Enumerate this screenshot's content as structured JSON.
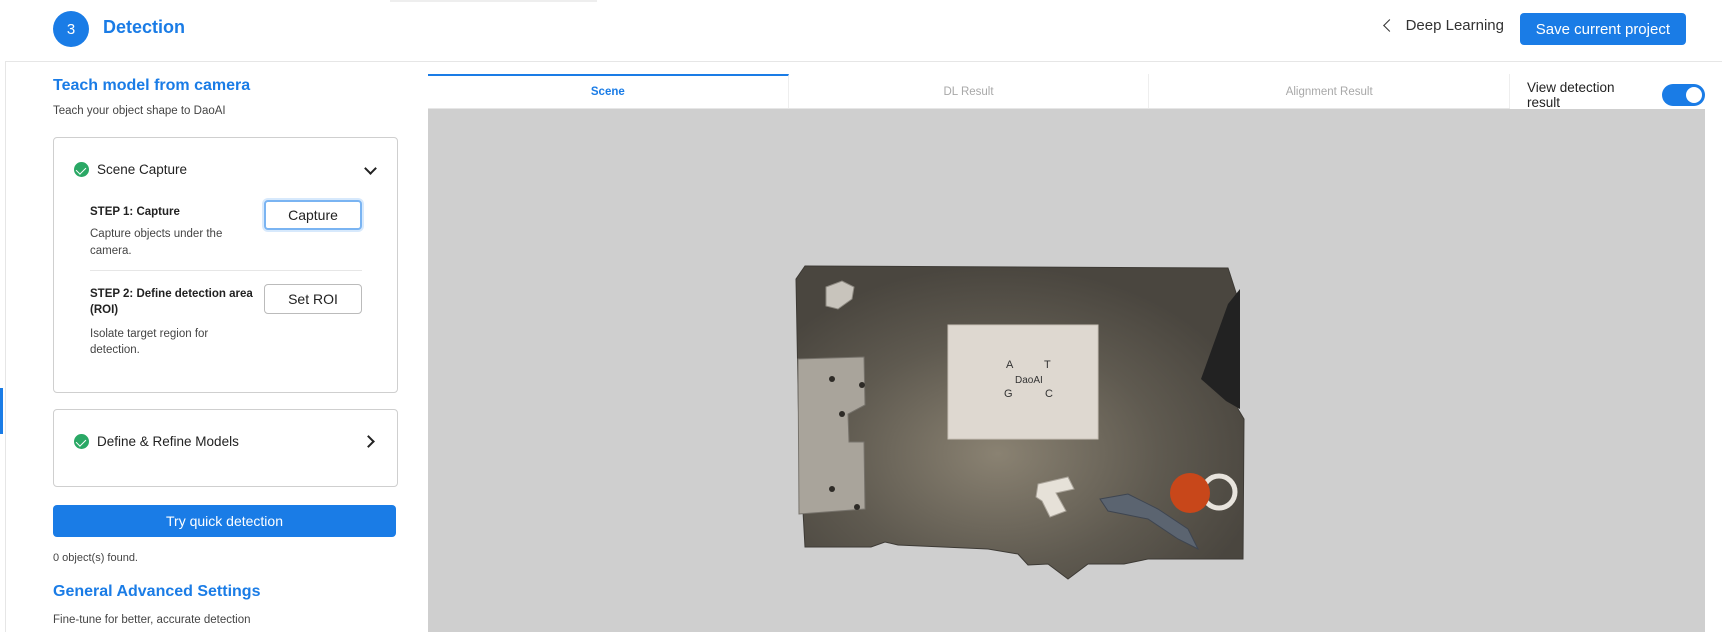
{
  "header": {
    "step_number": "3",
    "step_title": "Detection",
    "back_label": "Deep Learning",
    "save_label": "Save current project"
  },
  "sidebar": {
    "title": "Teach model from camera",
    "subtitle": "Teach your object shape to DaoAI",
    "scene_capture": {
      "title": "Scene Capture",
      "step1_label": "STEP 1: Capture",
      "step1_desc_line1": "Capture objects under the",
      "step1_desc_line2": "camera.",
      "capture_button": "Capture",
      "step2_label_line1": "STEP 2: Define detection area",
      "step2_label_line2": "(ROI)",
      "step2_desc_line1": "Isolate target region for",
      "step2_desc_line2": "detection.",
      "roi_button": "Set ROI"
    },
    "define_models": {
      "title": "Define & Refine Models"
    },
    "quick_detection_button": "Try quick detection",
    "objects_found": "0 object(s) found.",
    "advanced_title": "General Advanced Settings",
    "advanced_subtitle": "Fine-tune for better, accurate detection"
  },
  "viewer": {
    "tabs": [
      {
        "label": "Scene",
        "active": true
      },
      {
        "label": "DL Result",
        "active": false
      },
      {
        "label": "Alignment Result",
        "active": false
      }
    ],
    "toggle_label": "View detection result",
    "toggle_on": true,
    "scene": {
      "paper_letters": [
        "A",
        "T",
        "DaoAI",
        "G",
        "C"
      ]
    }
  },
  "colors": {
    "accent": "#1a7ce6",
    "success": "#2aa865",
    "canvas_bg": "#cfcfcf"
  }
}
